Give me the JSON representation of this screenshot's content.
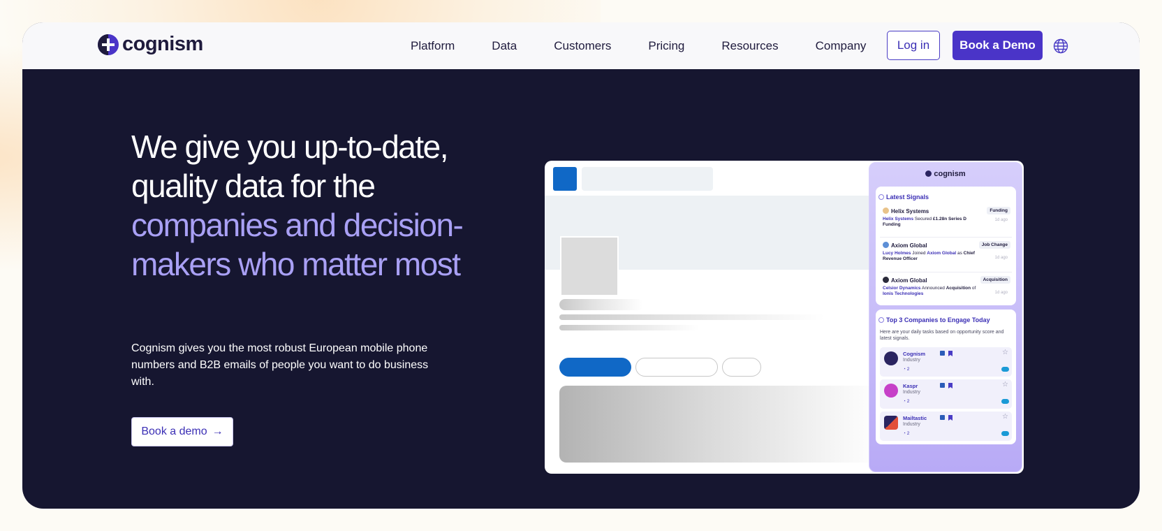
{
  "brand": {
    "name": "cognism",
    "accent": "#4a34c8",
    "hero_bg": "#161630"
  },
  "nav": {
    "links": [
      "Platform",
      "Data",
      "Customers",
      "Pricing",
      "Resources",
      "Company"
    ],
    "login_label": "Log in",
    "demo_label": "Book a Demo",
    "language_icon": "globe-icon"
  },
  "hero": {
    "headline_plain": "We give you up-to-date, quality data for the ",
    "headline_accent": "companies and decision-makers who matter most",
    "subtext": "Cognism gives you the most robust European mobile phone numbers and B2B emails of people you want to do business with.",
    "cta_label": "Book a demo",
    "cta_arrow": "→"
  },
  "mockup": {
    "panel_brand": "cognism",
    "latest_signals": {
      "title": "Latest Signals",
      "items": [
        {
          "company": "Helix Systems",
          "tag": "Funding",
          "parts": [
            [
              "lk",
              "Helix Systems"
            ],
            [
              "t",
              " Secured "
            ],
            [
              "b",
              "£1.28n Series D Funding"
            ]
          ],
          "time": "1d ago"
        },
        {
          "company": "Axiom Global",
          "tag": "Job Change",
          "parts": [
            [
              "lk",
              "Lucy Holmes"
            ],
            [
              "t",
              " Joined "
            ],
            [
              "lk",
              "Axiom Global"
            ],
            [
              "t",
              " as "
            ],
            [
              "b",
              "Chief Revenue Officer"
            ]
          ],
          "time": "1d ago"
        },
        {
          "company": "Axiom Global",
          "tag": "Acquisition",
          "parts": [
            [
              "lk",
              "Celsior Dynamics"
            ],
            [
              "t",
              " Announced "
            ],
            [
              "b",
              "Acquisition"
            ],
            [
              "t",
              " of "
            ],
            [
              "lk",
              "Ionis Technologies"
            ]
          ],
          "time": "1d ago"
        }
      ]
    },
    "top_companies": {
      "title": "Top 3 Companies to Engage Today",
      "description": "Here are your daily tasks based on opportunity score and latest signals.",
      "items": [
        {
          "name": "Cognism",
          "industry": "Industry",
          "count": "2",
          "color": "#2a2460"
        },
        {
          "name": "Kaspr",
          "industry": "Industry",
          "count": "2",
          "color": "#c640c8"
        },
        {
          "name": "Mailtastic",
          "industry": "Industry",
          "count": "2",
          "color": "#e2503a"
        }
      ]
    }
  }
}
